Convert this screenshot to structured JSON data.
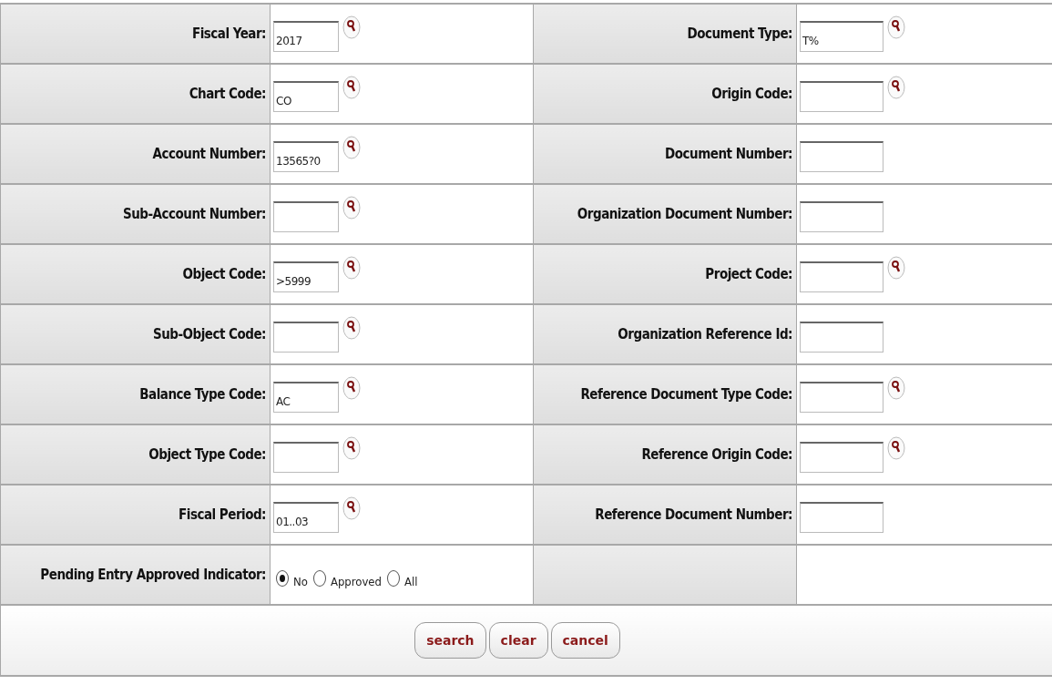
{
  "rows": [
    {
      "cells": [
        {
          "kind": "text",
          "label": "Fiscal Year:",
          "value": "2017",
          "lookup": true
        },
        {
          "kind": "text",
          "label": "Document Type:",
          "value": "T%",
          "lookup": true
        }
      ]
    },
    {
      "cells": [
        {
          "kind": "text",
          "label": "Chart Code:",
          "value": "CO",
          "lookup": true
        },
        {
          "kind": "text",
          "label": "Origin Code:",
          "lookup": true
        }
      ]
    },
    {
      "cells": [
        {
          "kind": "text",
          "label": "Account Number:",
          "value": "13565?0",
          "lookup": true
        },
        {
          "kind": "text",
          "label": "Document Number:",
          "lookup": false
        }
      ]
    },
    {
      "cells": [
        {
          "kind": "text",
          "label": "Sub-Account Number:",
          "lookup": true
        },
        {
          "kind": "text",
          "label": "Organization Document Number:",
          "lookup": false
        }
      ]
    },
    {
      "cells": [
        {
          "kind": "text",
          "label": "Object Code:",
          "value": ">5999",
          "lookup": true
        },
        {
          "kind": "text",
          "label": "Project Code:",
          "lookup": true
        }
      ]
    },
    {
      "cells": [
        {
          "kind": "text",
          "label": "Sub-Object Code:",
          "lookup": true
        },
        {
          "kind": "text",
          "label": "Organization Reference Id:",
          "lookup": false
        }
      ]
    },
    {
      "cells": [
        {
          "kind": "text",
          "label": "Balance Type Code:",
          "value": "AC",
          "lookup": true
        },
        {
          "kind": "text",
          "label": "Reference Document Type Code:",
          "lookup": true
        }
      ]
    },
    {
      "cells": [
        {
          "kind": "text",
          "label": "Object Type Code:",
          "lookup": true
        },
        {
          "kind": "text",
          "label": "Reference Origin Code:",
          "lookup": true
        }
      ]
    },
    {
      "cells": [
        {
          "kind": "text",
          "label": "Fiscal Period:",
          "value": "01..03",
          "lookup": true
        },
        {
          "kind": "text",
          "label": "Reference Document Number:",
          "lookup": false
        }
      ]
    },
    {
      "cells": [
        {
          "kind": "radio",
          "label": "Pending Entry Approved Indicator:",
          "options": [
            {
              "label": "No",
              "selected": true
            },
            {
              "label": "Approved",
              "selected": false
            },
            {
              "label": "All",
              "selected": false
            }
          ]
        },
        {
          "kind": "blank"
        }
      ]
    }
  ],
  "buttons": [
    "search",
    "clear",
    "cancel"
  ]
}
